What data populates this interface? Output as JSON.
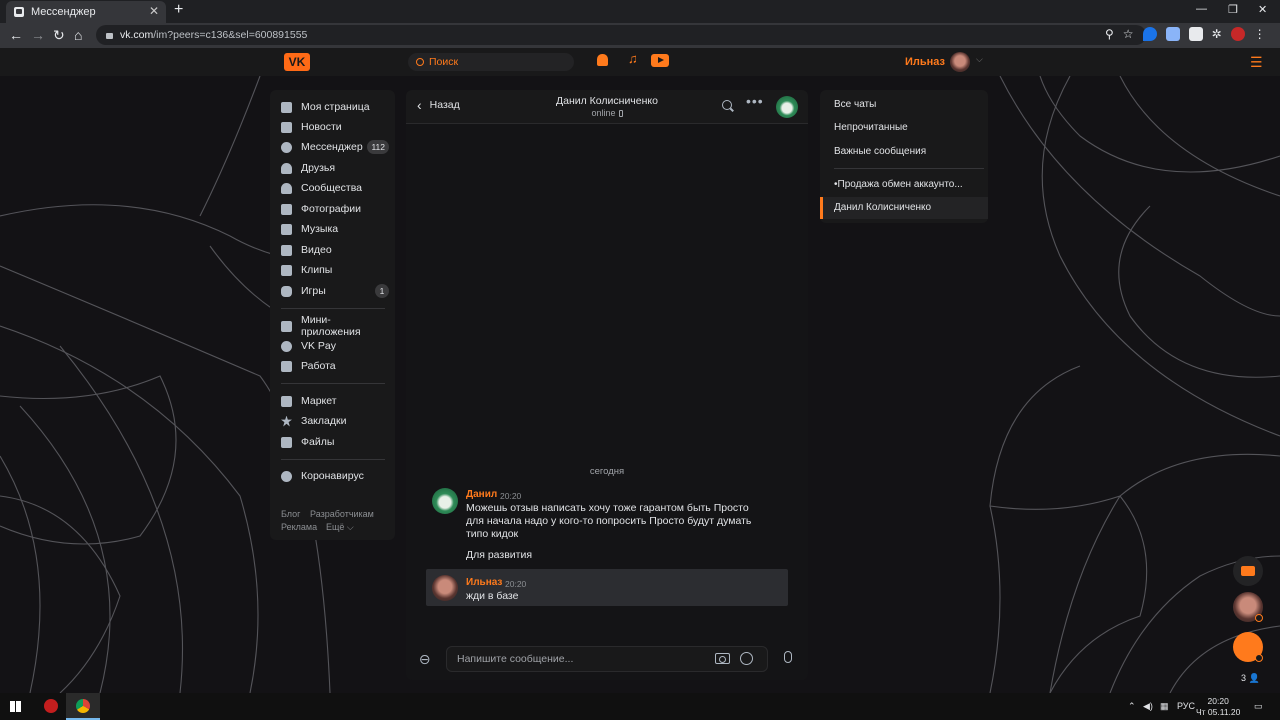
{
  "browser": {
    "tab_title": "Мессенджер",
    "tab_close": "✕",
    "new_tab": "+",
    "url_host": "vk.com",
    "url_path": "/im?peers=c136&sel=600891555",
    "win_min": "—",
    "win_restore": "❐",
    "win_close": "✕"
  },
  "header": {
    "logo": "VK",
    "search_placeholder": "Поиск",
    "user_name": "Ильназ"
  },
  "sidebar": {
    "items": [
      {
        "label": "Моя страница",
        "icon": "home-icon",
        "count": ""
      },
      {
        "label": "Новости",
        "icon": "news-icon",
        "count": ""
      },
      {
        "label": "Мессенджер",
        "icon": "message-icon",
        "count": "112"
      },
      {
        "label": "Друзья",
        "icon": "friend-icon",
        "count": ""
      },
      {
        "label": "Сообщества",
        "icon": "group-icon",
        "count": ""
      },
      {
        "label": "Фотографии",
        "icon": "camera-icon",
        "count": ""
      },
      {
        "label": "Музыка",
        "icon": "music-icon",
        "count": ""
      },
      {
        "label": "Видео",
        "icon": "video-icon",
        "count": ""
      },
      {
        "label": "Клипы",
        "icon": "clips-icon",
        "count": ""
      },
      {
        "label": "Игры",
        "icon": "gamepad-icon",
        "count": "1"
      },
      {
        "label": "Мини-приложения",
        "icon": "apps-icon",
        "count": ""
      },
      {
        "label": "VK Pay",
        "icon": "vkpay-icon",
        "count": ""
      },
      {
        "label": "Работа",
        "icon": "briefcase-icon",
        "count": ""
      },
      {
        "label": "Маркет",
        "icon": "bag-icon",
        "count": ""
      },
      {
        "label": "Закладки",
        "icon": "star-icon",
        "count": ""
      },
      {
        "label": "Файлы",
        "icon": "file-icon",
        "count": ""
      },
      {
        "label": "Коронавирус",
        "icon": "virus-icon",
        "count": ""
      }
    ],
    "footer": {
      "blog": "Блог",
      "developers": "Разработчикам",
      "ads": "Реклама",
      "more": "Ещё ⌵"
    }
  },
  "chat": {
    "back_label": "Назад",
    "peer_name": "Данил Колисниченко",
    "peer_status": "online",
    "date_separator": "сегодня",
    "messages": [
      {
        "author": "Данил",
        "time": "20:20",
        "lines": [
          "Можешь отзыв написать хочу тоже гарантом быть Просто",
          "для начала надо у кого-то попросить Просто будут думать",
          "типо кидок"
        ],
        "extra": "Для развития"
      },
      {
        "author": "Ильназ",
        "time": "20:20",
        "lines": [
          "жди в базе"
        ]
      }
    ],
    "composer_placeholder": "Напишите сообщение..."
  },
  "filters": {
    "items": [
      "Все чаты",
      "Непрочитанные",
      "Важные сообщения",
      "•Продажа обмен аккаунто...",
      "Данил Колисниченко"
    ],
    "selected_index": 4
  },
  "floating": {
    "online_count": "3"
  },
  "taskbar": {
    "lang": "РУС",
    "time": "20:20",
    "date": "Чт 05.11.20"
  },
  "colors": {
    "accent": "#ff7a1c",
    "background": "#131215",
    "panel": "#19191a"
  }
}
